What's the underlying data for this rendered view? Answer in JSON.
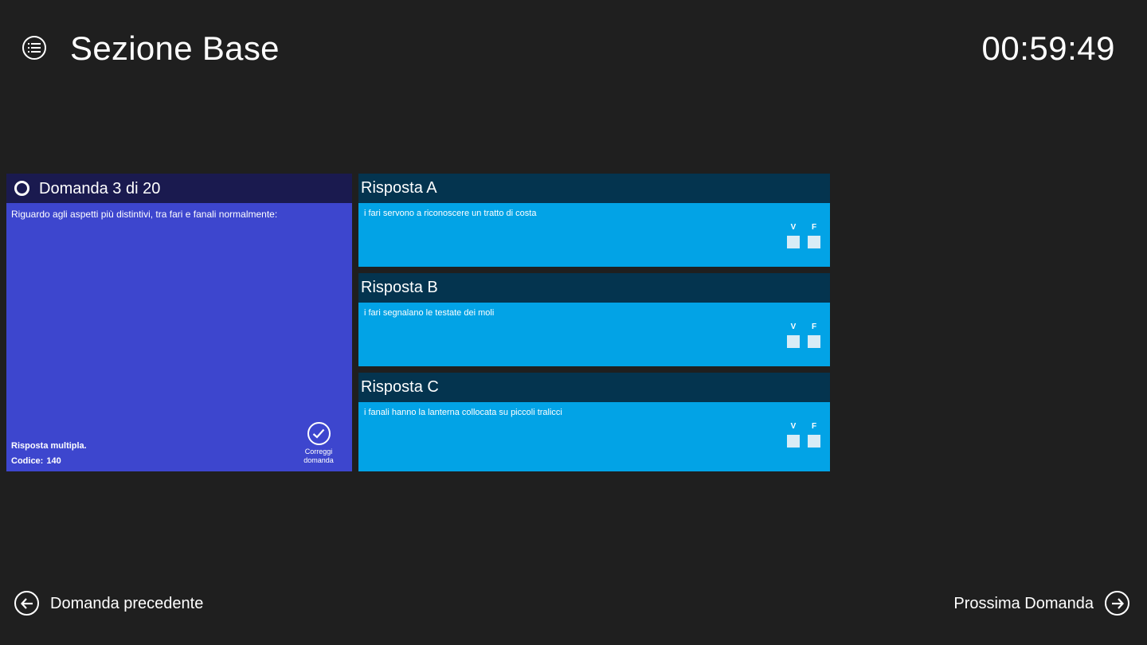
{
  "header": {
    "title": "Sezione Base",
    "menu_icon": "list-icon",
    "timer": "00:59:49"
  },
  "question": {
    "title": "Domanda 3 di 20",
    "text": "Riguardo agli aspetti più distintivi, tra fari e fanali normalmente:",
    "type_label": "Risposta multipla.",
    "code_label": "Codice:",
    "code_value": "140",
    "check_button_line1": "Correggi",
    "check_button_line2": "domanda",
    "colors": {
      "header": "#1a1a4f",
      "body": "#3d46ce"
    }
  },
  "answers": [
    {
      "title": "Risposta A",
      "text": "i fari servono a riconoscere un tratto di costa",
      "true_label": "V",
      "false_label": "F"
    },
    {
      "title": "Risposta B",
      "text": "i fari segnalano le testate dei moli",
      "true_label": "V",
      "false_label": "F"
    },
    {
      "title": "Risposta C",
      "text": "i fanali hanno la lanterna collocata su piccoli tralicci",
      "true_label": "V",
      "false_label": "F"
    }
  ],
  "answer_colors": {
    "header": "#04344f",
    "body": "#02a3e6"
  },
  "nav": {
    "prev_label": "Domanda precedente",
    "next_label": "Prossima Domanda"
  }
}
